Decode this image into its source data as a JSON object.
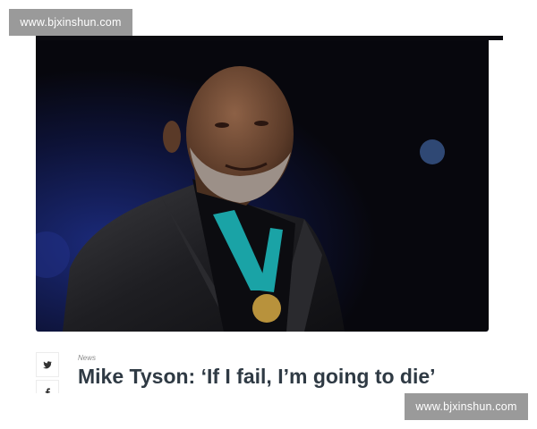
{
  "watermark": {
    "top": "www.bjxinshun.com",
    "bottom": "www.bjxinshun.com"
  },
  "article": {
    "category": "News",
    "headline": "Mike Tyson: ‘If I fail, I’m going to die’"
  },
  "share": {
    "icons": [
      "twitter-icon",
      "facebook-icon"
    ]
  },
  "colors": {
    "headline": "#2f3a44",
    "category": "#8a8a8a",
    "watermark_bg": "#9a9a9a",
    "photo_bg": "#0b0b12"
  }
}
